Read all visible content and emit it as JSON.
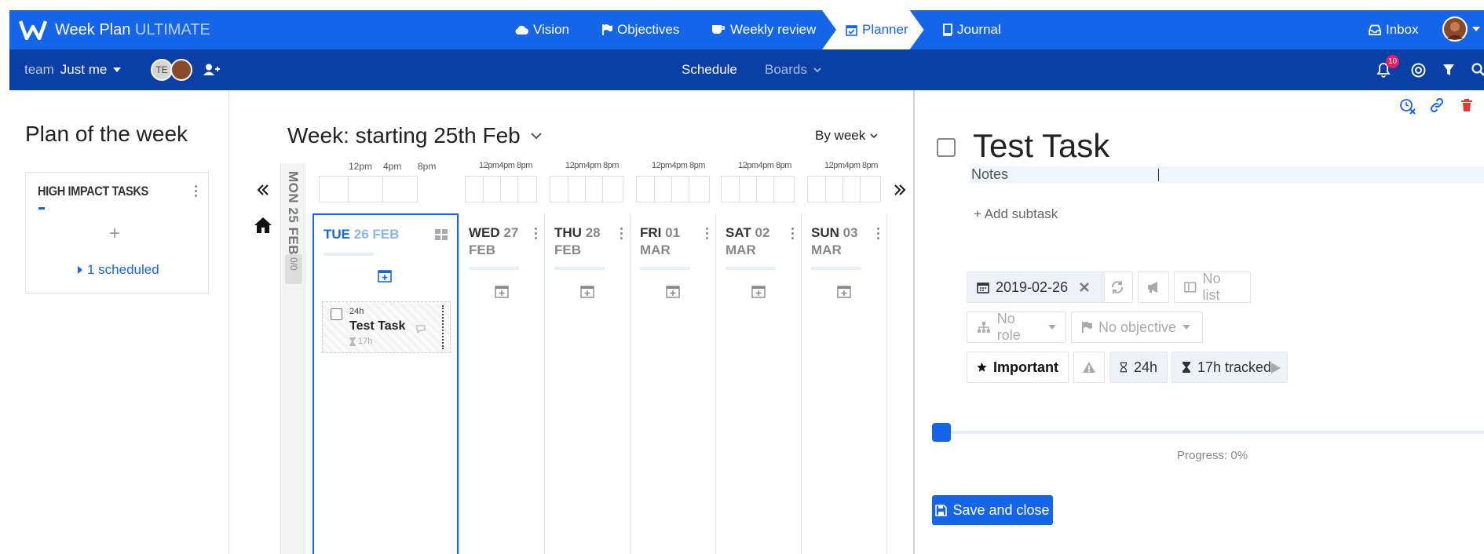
{
  "app": {
    "title": "Week Plan",
    "edition": "ULTIMATE"
  },
  "nav": {
    "items": [
      {
        "label": "Vision",
        "icon": "cloud-icon"
      },
      {
        "label": "Objectives",
        "icon": "flag-icon"
      },
      {
        "label": "Weekly review",
        "icon": "coffee-icon"
      },
      {
        "label": "Planner",
        "icon": "calendar-check-icon",
        "active": true
      },
      {
        "label": "Journal",
        "icon": "book-icon"
      }
    ],
    "inbox": "Inbox"
  },
  "subnav": {
    "team_prefix": "team",
    "team_name": "Just me",
    "avatar_initials": "TE",
    "schedule": "Schedule",
    "boards": "Boards",
    "notifications_count": "10"
  },
  "left": {
    "title": "Plan of the week",
    "section_title": "HIGH IMPACT TASKS",
    "add": "+",
    "scheduled": "1 scheduled"
  },
  "week": {
    "title": "Week: starting 25th Feb",
    "mode": "By week",
    "collapsed_day": "MON 25 FEB",
    "collapsed_count": "0/0",
    "days": [
      {
        "name": "TUE",
        "num": "26 FEB",
        "month": ""
      },
      {
        "name": "WED",
        "num": "27",
        "month": "FEB"
      },
      {
        "name": "THU",
        "num": "28",
        "month": "FEB"
      },
      {
        "name": "FRI",
        "num": "01",
        "month": "MAR"
      },
      {
        "name": "SAT",
        "num": "02",
        "month": "MAR"
      },
      {
        "name": "SUN",
        "num": "03",
        "month": "MAR"
      }
    ],
    "timeline_labels": [
      "12pm",
      "4pm",
      "8pm"
    ],
    "task": {
      "duration": "24h",
      "title": "Test Task",
      "tracked": "17h"
    }
  },
  "detail": {
    "title": "Test Task",
    "notes_placeholder": "Notes",
    "add_subtask": "+ Add subtask",
    "date": "2019-02-26",
    "list": "No list",
    "role": "No role",
    "objective": "No objective",
    "important": "Important",
    "duration": "24h",
    "tracked": "17h tracked",
    "progress_label": "Progress: 0%",
    "progress": 0,
    "save": "Save and close"
  },
  "colors": {
    "primary": "#1565e8",
    "dark_bar": "#0a3fa6",
    "danger": "#e53935"
  }
}
